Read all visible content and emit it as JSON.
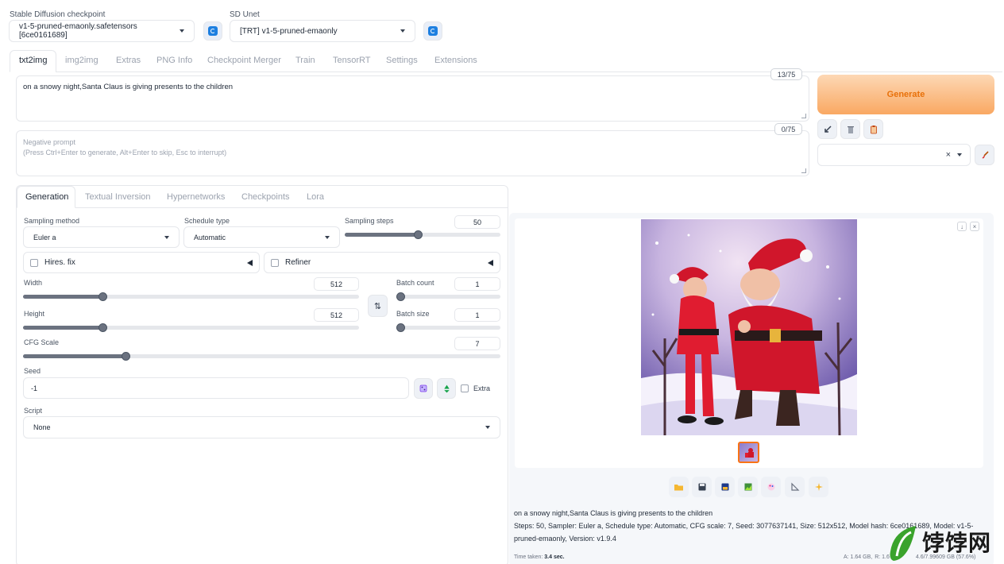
{
  "top": {
    "checkpoint_label": "Stable Diffusion checkpoint",
    "checkpoint_value": "v1-5-pruned-emaonly.safetensors [6ce0161689]",
    "unet_label": "SD Unet",
    "unet_value": "[TRT] v1-5-pruned-emaonly"
  },
  "tabs": [
    "txt2img",
    "img2img",
    "Extras",
    "PNG Info",
    "Checkpoint Merger",
    "Train",
    "TensorRT",
    "Settings",
    "Extensions"
  ],
  "prompt": {
    "text": "on a snowy night,Santa Claus is giving presents to the children",
    "counter": "13/75",
    "negative_placeholder_1": "Negative prompt",
    "negative_placeholder_2": "(Press Ctrl+Enter to generate, Alt+Enter to skip, Esc to interrupt)",
    "negative_counter": "0/75"
  },
  "generate_label": "Generate",
  "style_clear": "×",
  "subtabs": [
    "Generation",
    "Textual Inversion",
    "Hypernetworks",
    "Checkpoints",
    "Lora"
  ],
  "generation": {
    "sampling_method_label": "Sampling method",
    "sampling_method_value": "Euler a",
    "schedule_type_label": "Schedule type",
    "schedule_type_value": "Automatic",
    "sampling_steps_label": "Sampling steps",
    "sampling_steps_value": "50",
    "sampling_steps_fraction": 0.47,
    "hires_label": "Hires. fix",
    "refiner_label": "Refiner",
    "width_label": "Width",
    "width_value": "512",
    "width_fraction": 0.23,
    "height_label": "Height",
    "height_value": "512",
    "height_fraction": 0.23,
    "batch_count_label": "Batch count",
    "batch_count_value": "1",
    "batch_count_fraction": 0.0,
    "batch_size_label": "Batch size",
    "batch_size_value": "1",
    "batch_size_fraction": 0.0,
    "cfg_label": "CFG Scale",
    "cfg_value": "7",
    "cfg_fraction": 0.21,
    "swap_icon": "⇅",
    "seed_label": "Seed",
    "seed_value": "-1",
    "extra_label": "Extra",
    "script_label": "Script",
    "script_value": "None"
  },
  "output": {
    "info_prompt": "on a snowy night,Santa Claus is giving presents to the children",
    "info_params_1": "Steps: 50, Sampler: Euler a, Schedule type: Automatic, CFG scale: 7, Seed: 3077637141, Size: 512x512, Model hash: 6ce0161689, Model: v1-5-",
    "info_params_2": "pruned-emaonly, Version: v1.9.4",
    "time_label": "Time taken:",
    "time_value": "3.4 sec.",
    "vram_a": "A: 1.64 GB,",
    "vram_r": "R: 1.6",
    "vram_sys": "4.6/7.99609 GB (57.6%)"
  },
  "watermark": "饽饽网",
  "colors": {
    "generate_start": "#fbd3ad",
    "generate_end": "#f9a65c",
    "generate_text": "#e8710a",
    "refresh_icon": "#1d7fe0",
    "watermark_green": "#3aa32c"
  },
  "icons": [
    "refresh-icon",
    "arrow-icon",
    "trash-icon",
    "clipboard-icon",
    "brush-icon",
    "dice-icon",
    "recycle-icon",
    "download-icon",
    "close-icon",
    "folder-icon",
    "save-icon",
    "zip-icon",
    "image-icon",
    "palette-icon",
    "ruler-icon",
    "sparkle-icon"
  ]
}
